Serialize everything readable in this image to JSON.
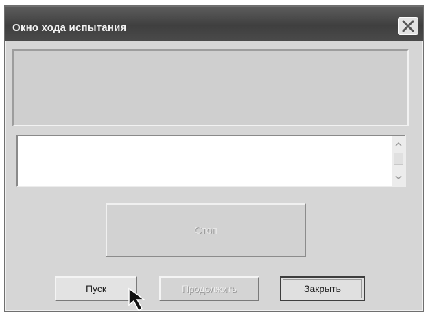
{
  "window": {
    "title": "Окно хода испытания",
    "close_icon": "close-icon"
  },
  "log": {
    "text": ""
  },
  "buttons": {
    "stop_label": "Стоп",
    "start_label": "Пуск",
    "continue_label": "Продолжить",
    "close_label": "Закрыть"
  },
  "colors": {
    "title_bar": "#444444",
    "window_bg": "#d6d6d6"
  }
}
